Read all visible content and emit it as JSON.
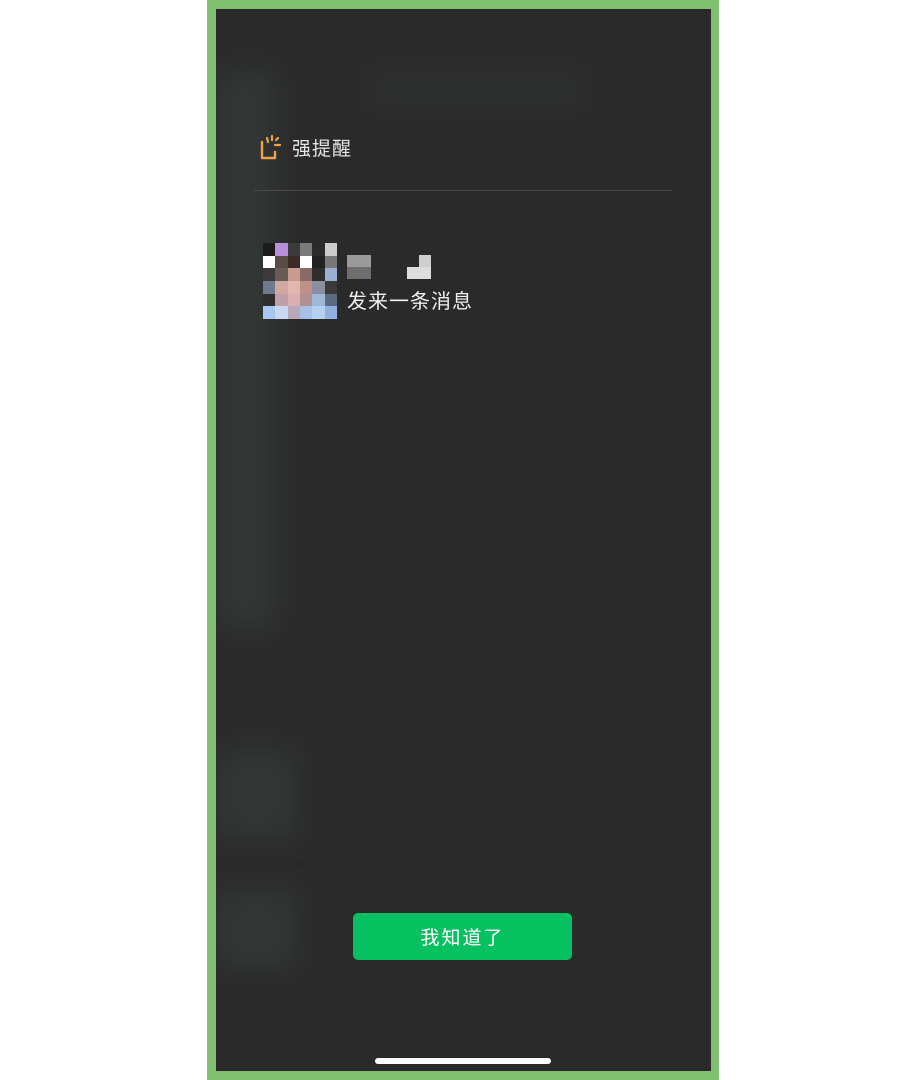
{
  "alert": {
    "title": "强提醒",
    "icon": "tap-alert-icon",
    "icon_color": "#f0a24a"
  },
  "message": {
    "sender_name": "",
    "body": "发来一条消息"
  },
  "actions": {
    "acknowledge_label": "我知道了",
    "accent_color": "#07c160"
  },
  "colors": {
    "background": "#2a2a2a",
    "frame": "#7fbf6f"
  }
}
